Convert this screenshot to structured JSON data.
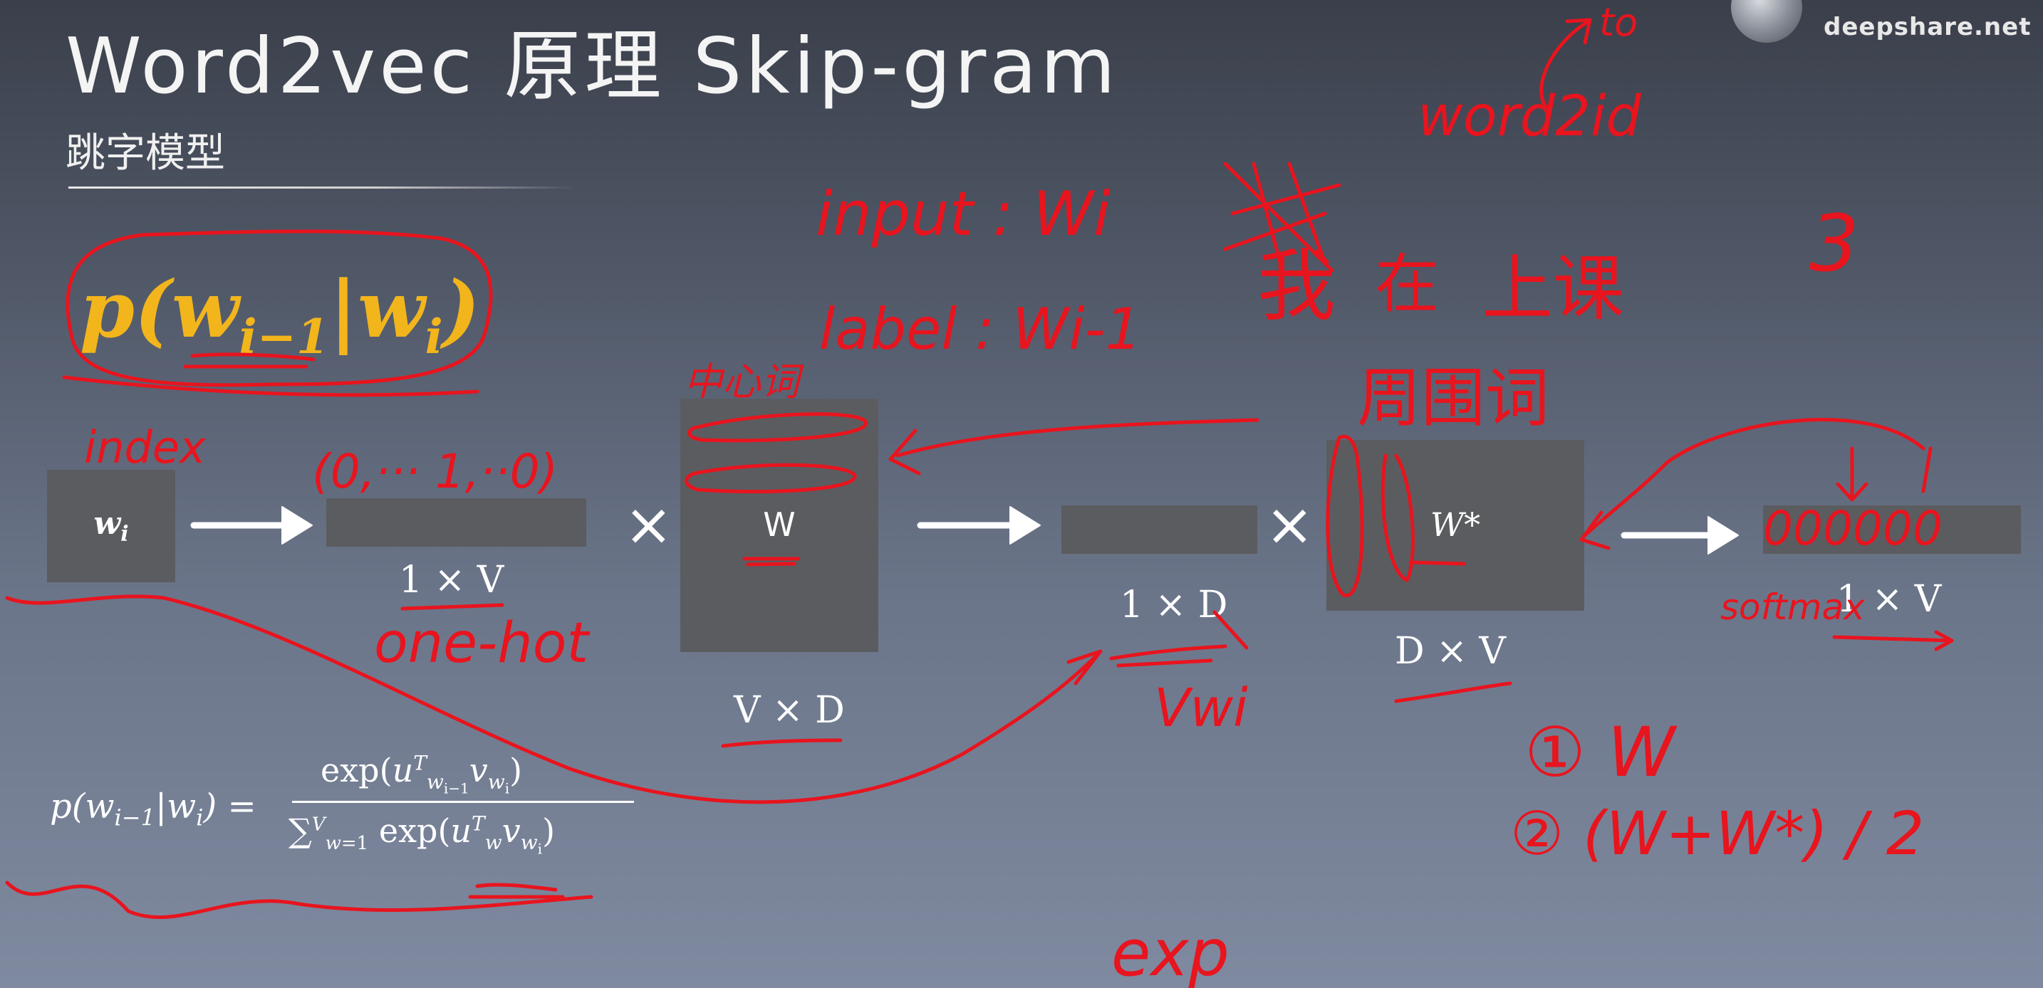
{
  "slide": {
    "title": "Word2vec 原理 Skip-gram",
    "subtitle": "跳字模型",
    "watermark": "deepshare.net"
  },
  "diagram": {
    "main_probability": "p(w i−1 | w i)",
    "input_box_label": "w i",
    "onehot_dim": "1 × V",
    "w_matrix_label": "W",
    "w_matrix_dim": "V × D",
    "hidden_dim": "1 × D",
    "wstar_matrix_label": "W*",
    "wstar_matrix_dim": "D × V",
    "output_dim": "1 × V",
    "times_symbol": "×"
  },
  "formula": {
    "lhs": "p(w i−1|w i) =",
    "numerator": "exp(uᵀ w i−1 v w i)",
    "denominator": "Σ V w=1 exp(uᵀ w v w i)"
  },
  "annotations": {
    "input": "input : Wi",
    "label": "label : Wi-1",
    "index": "index",
    "onehot_vector": "(0,··· 1,··0)",
    "one_hot": "one-hot",
    "center_word": "中心词",
    "word_id": "word2id",
    "to": "to",
    "sentence_1": "我",
    "sentence_2": "在",
    "sentence_3": "上课",
    "context_word": "周围词",
    "v_wi": "Vwi",
    "softmax": "softmax",
    "option_1": "① W",
    "option_2": "② (W+W*) / 2",
    "exp": "exp",
    "digit_3": "3",
    "output_zeros": "000000"
  },
  "colors": {
    "ink": "#e8141e",
    "highlight": "#f2b51c",
    "box": "#5b5c60"
  }
}
